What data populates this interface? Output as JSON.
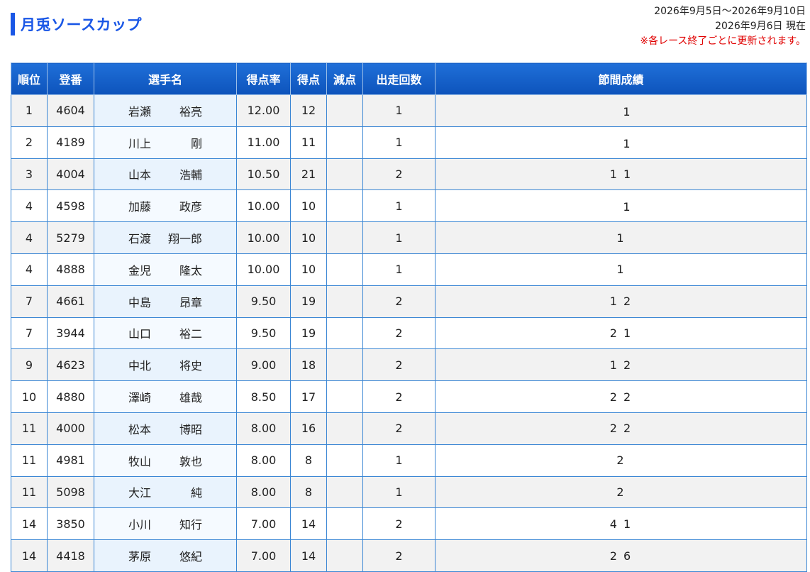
{
  "header": {
    "title": "月兎ソースカップ",
    "date_range": "2026年9月5日〜2026年9月10日",
    "as_of": "2026年9月6日 現在",
    "notice": "※各レース終了ごとに更新されます。"
  },
  "columns": [
    "順位",
    "登番",
    "選手名",
    "得点率",
    "得点",
    "減点",
    "出走回数",
    "節間成績"
  ],
  "rows": [
    {
      "rank": "1",
      "reg": "4604",
      "last": "岩瀬",
      "first": "裕亮",
      "rate": "12.00",
      "points": "12",
      "deduct": "",
      "starts": "1",
      "series": "　1"
    },
    {
      "rank": "2",
      "reg": "4189",
      "last": "川上",
      "first": "剛",
      "rate": "11.00",
      "points": "11",
      "deduct": "",
      "starts": "1",
      "series": "　1"
    },
    {
      "rank": "3",
      "reg": "4004",
      "last": "山本",
      "first": "浩輔",
      "rate": "10.50",
      "points": "21",
      "deduct": "",
      "starts": "2",
      "series": "1 1"
    },
    {
      "rank": "4",
      "reg": "4598",
      "last": "加藤",
      "first": "政彦",
      "rate": "10.00",
      "points": "10",
      "deduct": "",
      "starts": "1",
      "series": "　1"
    },
    {
      "rank": "4",
      "reg": "5279",
      "last": "石渡",
      "first": "翔一郎",
      "rate": "10.00",
      "points": "10",
      "deduct": "",
      "starts": "1",
      "series": "1"
    },
    {
      "rank": "4",
      "reg": "4888",
      "last": "金児",
      "first": "隆太",
      "rate": "10.00",
      "points": "10",
      "deduct": "",
      "starts": "1",
      "series": "1"
    },
    {
      "rank": "7",
      "reg": "4661",
      "last": "中島",
      "first": "昂章",
      "rate": "9.50",
      "points": "19",
      "deduct": "",
      "starts": "2",
      "series": "1 2"
    },
    {
      "rank": "7",
      "reg": "3944",
      "last": "山口",
      "first": "裕二",
      "rate": "9.50",
      "points": "19",
      "deduct": "",
      "starts": "2",
      "series": "2 1"
    },
    {
      "rank": "9",
      "reg": "4623",
      "last": "中北",
      "first": "将史",
      "rate": "9.00",
      "points": "18",
      "deduct": "",
      "starts": "2",
      "series": "1 2"
    },
    {
      "rank": "10",
      "reg": "4880",
      "last": "澤崎",
      "first": "雄哉",
      "rate": "8.50",
      "points": "17",
      "deduct": "",
      "starts": "2",
      "series": "2 2"
    },
    {
      "rank": "11",
      "reg": "4000",
      "last": "松本",
      "first": "博昭",
      "rate": "8.00",
      "points": "16",
      "deduct": "",
      "starts": "2",
      "series": "2 2"
    },
    {
      "rank": "11",
      "reg": "4981",
      "last": "牧山",
      "first": "敦也",
      "rate": "8.00",
      "points": "8",
      "deduct": "",
      "starts": "1",
      "series": "2"
    },
    {
      "rank": "11",
      "reg": "5098",
      "last": "大江",
      "first": "純",
      "rate": "8.00",
      "points": "8",
      "deduct": "",
      "starts": "1",
      "series": "2"
    },
    {
      "rank": "14",
      "reg": "3850",
      "last": "小川",
      "first": "知行",
      "rate": "7.00",
      "points": "14",
      "deduct": "",
      "starts": "2",
      "series": "4 1"
    },
    {
      "rank": "14",
      "reg": "4418",
      "last": "茅原",
      "first": "悠紀",
      "rate": "7.00",
      "points": "14",
      "deduct": "",
      "starts": "2",
      "series": "2 6"
    }
  ]
}
